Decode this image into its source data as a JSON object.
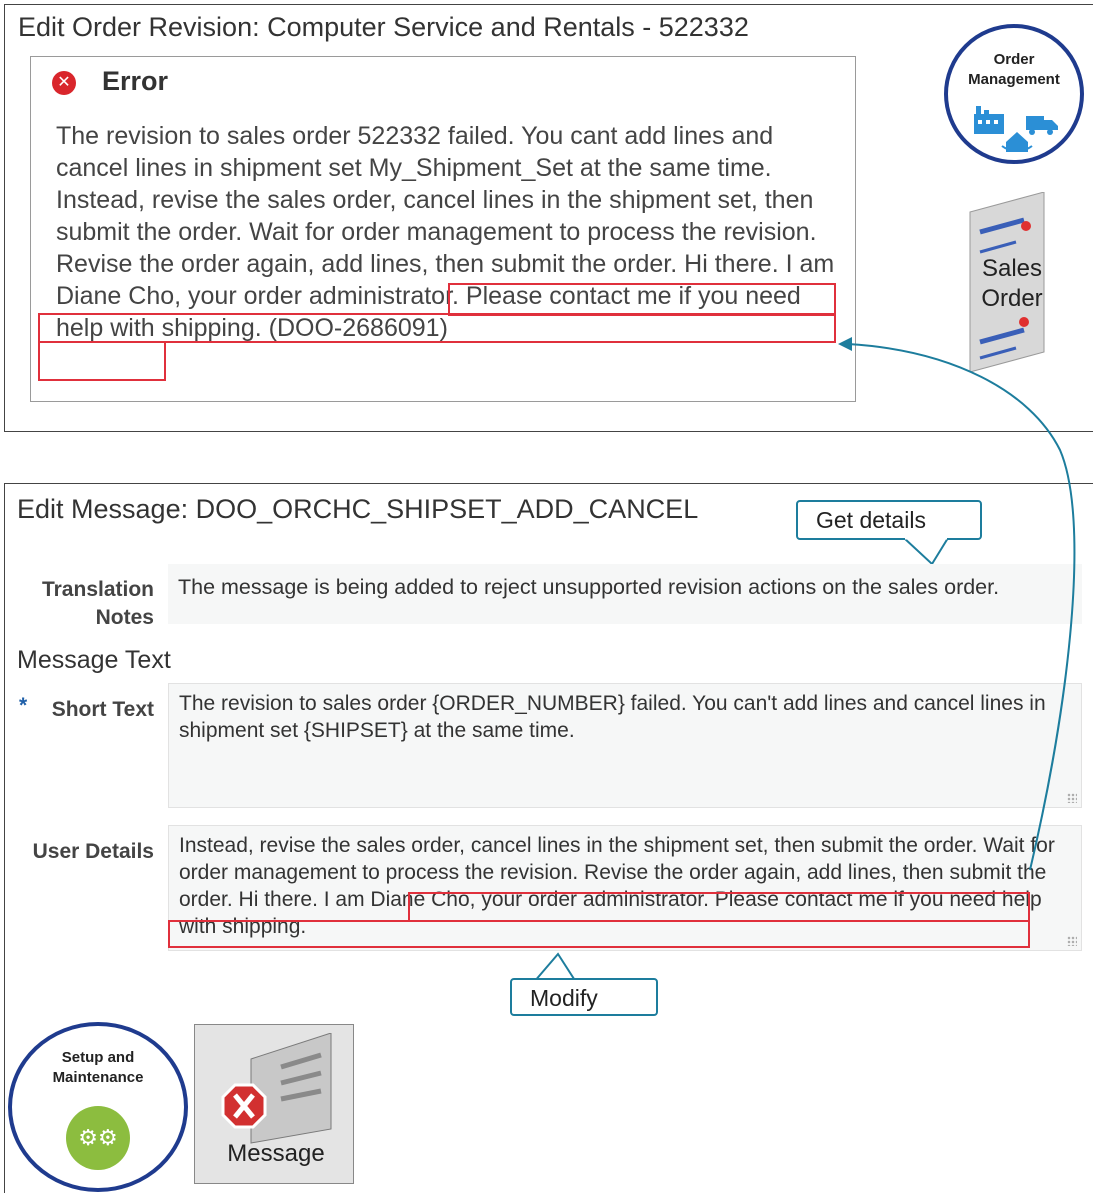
{
  "top": {
    "title": "Edit Order Revision: Computer Service and Rentals - 522332",
    "error": {
      "icon": "error-icon",
      "title": "Error",
      "message_part1": "The revision to sales order 522332 failed. You cant add lines and cancel lines in shipment set My_Shipment_Set at the same time. Instead, revise the sales order, cancel lines in the shipment set, then submit the order. Wait for order management to process the revision. Revise the order again, add lines, then submit the order.",
      "message_highlight": "Hi there. I am Diane Cho, your order administrator. Please contact me if you need help with shipping.",
      "message_code": "(DOO-2686091)"
    },
    "order_management_badge": {
      "line1": "Order",
      "line2": "Management",
      "icon": "factory-truck-house-icon"
    },
    "sales_order_tile": {
      "line1": "Sales",
      "line2": "Order"
    }
  },
  "bottom": {
    "title": "Edit Message: DOO_ORCHC_SHIPSET_ADD_CANCEL",
    "callout_get_details": "Get details",
    "translation_notes": {
      "label_line1": "Translation",
      "label_line2": "Notes",
      "value": "The message is being added to reject unsupported revision actions on the sales order."
    },
    "message_text_heading": "Message Text",
    "short_text": {
      "required_mark": "*",
      "label": "Short Text",
      "value": "The revision to sales order {ORDER_NUMBER} failed. You can't add lines and cancel lines in shipment set {SHIPSET} at the same time."
    },
    "user_details": {
      "label": "User Details",
      "value_part1": "Instead, revise the sales order, cancel lines in the shipment set, then submit the order. Wait for order management to process the revision. Revise the order again, add lines, then submit the order.",
      "value_highlight": "Hi there. I am Diane Cho, your order administrator. Please contact me if you need help with shipping."
    },
    "callout_modify": "Modify",
    "setup_badge": {
      "line1": "Setup and",
      "line2": "Maintenance",
      "icon": "gears-icon"
    },
    "message_tile": {
      "label": "Message",
      "icon": "error-document-icon"
    }
  },
  "colors": {
    "highlight_red": "#e0303c",
    "arrow_teal": "#1d7d9d",
    "badge_blue": "#1f3b8e",
    "gear_green": "#8cbd3f",
    "error_red": "#d9262c"
  }
}
